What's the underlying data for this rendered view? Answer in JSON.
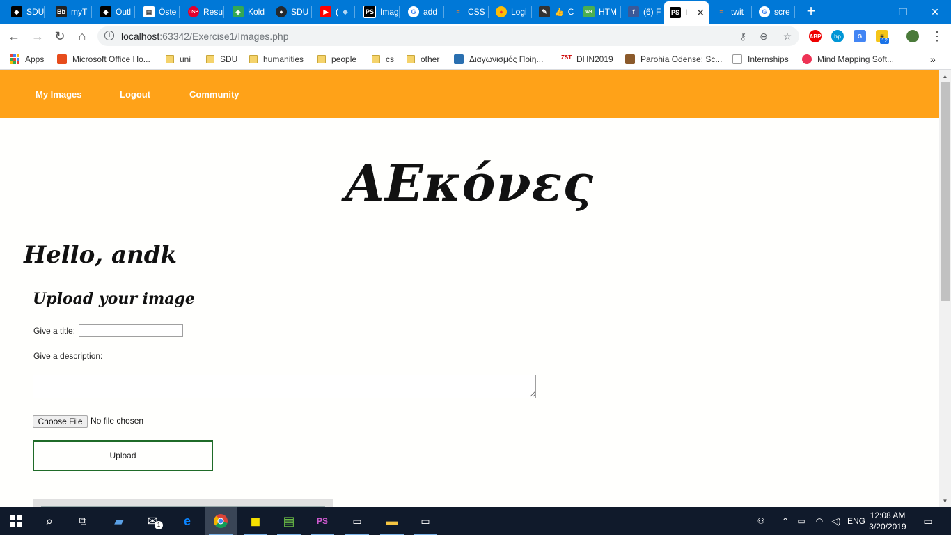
{
  "browser": {
    "tabs": [
      {
        "label": "SDU",
        "icon": "sdu-icon",
        "color": "#000000"
      },
      {
        "label": "myT",
        "icon": "blackboard-icon",
        "color": "#222222"
      },
      {
        "label": "Outl",
        "icon": "sdu-icon",
        "color": "#000000"
      },
      {
        "label": "Öste",
        "icon": "web-icon",
        "color": "#ffffff"
      },
      {
        "label": "Resu",
        "icon": "dsb-icon",
        "color": "#e4002b"
      },
      {
        "label": "Kold",
        "icon": "maps-icon",
        "color": "#34a853"
      },
      {
        "label": "SDU",
        "icon": "github-icon",
        "color": "#24292e"
      },
      {
        "label": "(",
        "icon": "youtube-icon",
        "color": "#ff0000"
      },
      {
        "label": "Imag",
        "icon": "phpstorm-icon",
        "color": "#000000"
      },
      {
        "label": "add",
        "icon": "google-icon",
        "color": "#4285f4"
      },
      {
        "label": "CSS",
        "icon": "stackoverflow-icon",
        "color": "#f48024"
      },
      {
        "label": "Logi",
        "icon": "logo-icon",
        "color": "#fbbc05"
      },
      {
        "label": "C",
        "icon": "edit-icon",
        "color": "#333333"
      },
      {
        "label": "HTM",
        "icon": "w3schools-icon",
        "color": "#4caf50"
      },
      {
        "label": "(6) F",
        "icon": "facebook-icon",
        "color": "#3b5998"
      },
      {
        "label": "I",
        "icon": "phpstorm-icon",
        "color": "#000000",
        "active": true
      },
      {
        "label": "twit",
        "icon": "stackoverflow-icon",
        "color": "#f48024"
      },
      {
        "label": "scre",
        "icon": "google-icon",
        "color": "#4285f4"
      }
    ],
    "address": {
      "host": "localhost",
      "path": ":63342/Exercise1/Images.php"
    },
    "bookmarks": [
      {
        "label": "Apps",
        "type": "apps"
      },
      {
        "label": "Microsoft Office Ho...",
        "type": "office"
      },
      {
        "label": "uni",
        "type": "folder"
      },
      {
        "label": "SDU",
        "type": "folder"
      },
      {
        "label": "humanities",
        "type": "folder"
      },
      {
        "label": "people",
        "type": "folder"
      },
      {
        "label": "cs",
        "type": "folder"
      },
      {
        "label": "other",
        "type": "folder"
      },
      {
        "label": "Διαγωνισμός Ποίη...",
        "type": "site"
      },
      {
        "label": "DHN2019",
        "type": "site"
      },
      {
        "label": "Parohia Odense: Sc...",
        "type": "site"
      },
      {
        "label": "Internships",
        "type": "site"
      },
      {
        "label": "Mind Mapping Soft...",
        "type": "site"
      }
    ],
    "extensions": {
      "weather_badge": "12"
    }
  },
  "page": {
    "nav": {
      "my_images": "My Images",
      "logout": "Logout",
      "community": "Community"
    },
    "logo_text": "AEκόνες",
    "greeting": "Hello, andk",
    "upload": {
      "heading": "Upload your image",
      "title_label": "Give a title:",
      "title_value": "",
      "description_label": "Give a description:",
      "description_value": "",
      "choose_file_label": "Choose File",
      "file_status": "No file chosen",
      "upload_button": "Upload"
    },
    "colors": {
      "navbar": "#ffa218",
      "upload_border": "#1f6b28"
    }
  },
  "taskbar": {
    "language": "ENG",
    "time": "12:08 AM",
    "date": "3/20/2019",
    "mail_badge": "1"
  }
}
